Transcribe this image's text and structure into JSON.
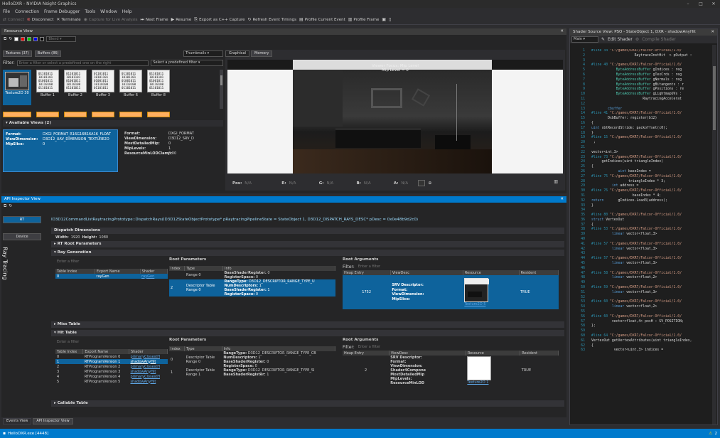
{
  "window": {
    "title": "HelloDXR - NVIDIA Nsight Graphics",
    "controls": [
      "–",
      "□",
      "✕"
    ]
  },
  "menu": [
    "File",
    "Connection",
    "Frame Debugger",
    "Tools",
    "Window",
    "Help"
  ],
  "toolbar": {
    "connect": "Connect",
    "disconnect": "Disconnect",
    "terminate": "Terminate",
    "capture": "Capture for Live Analysis",
    "next_frame": "Next Frame",
    "resume": "Resume",
    "export": "Export as C++ Capture",
    "refresh": "Refresh Event Timings",
    "profile_current": "Profile Current Event",
    "profile_frame": "Profile Frame"
  },
  "resource_view": {
    "title": "Resource View",
    "blend": "Blend",
    "tab_textures": "Textures (37)",
    "tab_buffers": "Buffers (86)",
    "view_mode": "Thumbnails",
    "filter_label": "Filter:",
    "filter_placeholder": "Enter a filter or select a predefined one on the right",
    "predefined_placeholder": "Select a predefined filter",
    "texture_label": "Texture2D 30",
    "buffer_bits": "01101011\n10101101\n01001011\n10110100\n01101011",
    "buffers": [
      "Buffer 1",
      "Buffer 2",
      "Buffer 3",
      "Buffer 6",
      "Buffer 8"
    ],
    "available_views": "Available Views (2)",
    "view1": {
      "format_k": "Format:",
      "format_v": "DXGI_FORMAT_R16G16B16A16_FLOAT",
      "dim_k": "ViewDimension:",
      "dim_v": "D3D12_UAV_DIMENSION_TEXTURE2D",
      "mip_k": "MipSlice:",
      "mip_v": "0"
    },
    "view2": {
      "format_k": "Format:",
      "format_v": "DXGI_FORMAT",
      "dim_k": "ViewDimension:",
      "dim_v": "D3D12_SRV_D",
      "mdm_k": "MostDetailedMip:",
      "mdm_v": "0",
      "ml_k": "MipLevels:",
      "ml_v": "1",
      "rmc_k": "ResourceMinLODClamp:",
      "rmc_v": "0.00"
    }
  },
  "graphical": {
    "tab_graphical": "Graphical",
    "tab_memory": "Memory",
    "overlay1": "Viewer Focus: Mip Level",
    "overlay2": "Mip Level = 0",
    "pos_k": "Pos:",
    "na": "N/A",
    "r_k": "R:",
    "g_k": "G:",
    "b_k": "B:",
    "a_k": "A:"
  },
  "api_inspector": {
    "title": "API Inspector View",
    "rt_button": "RT",
    "device_button": "Device",
    "side_label": "Ray Tracing",
    "call": "ID3D12CommandListRaytracingPrototype::DispatchRays(ID3D12StateObjectPrototype* pRaytracingPipelineState = StateObject 1, D3D12_DISPATCH_RAYS_DESC* pDesc = 0x0e48b9d2c0)",
    "dispatch_dims": "Dispatch Dimensions",
    "width_k": "Width:",
    "width_v": "1920",
    "height_k": "Height:",
    "height_v": "1080",
    "rt_root_params": "RT Root Parameters",
    "ray_generation": "Ray Generation",
    "miss_table": "Miss Table",
    "hit_table": "Hit Table",
    "callable_table": "Callable Table",
    "filter_placeholder": "Enter a filter",
    "root_parameters": "Root Parameters",
    "root_arguments": "Root Arguments",
    "filter_label": "Filter:",
    "cols_table": [
      "Table Index",
      "Export Name",
      "Shader"
    ],
    "cols_root": [
      "Index",
      "Type",
      "Info"
    ],
    "cols_args": [
      "Heap Entry",
      "ViewDesc",
      "Resource",
      "Resident"
    ],
    "raygen_row": [
      "0",
      "rayGen",
      "rayGen"
    ],
    "root_rows": [
      {
        "index": "",
        "type": "Range 0",
        "info": [
          [
            "BaseShaderRegister:",
            "0"
          ],
          [
            "RegisterSpace:",
            "0"
          ]
        ]
      },
      {
        "index": "2",
        "type": "Descriptor Table\nRange 0",
        "info": [
          [
            "RangeType:",
            "D3D12_DESCRIPTOR_RANGE_TYPE_U"
          ],
          [
            "NumDescriptors:",
            "1"
          ],
          [
            "BaseShaderRegister:",
            "1"
          ],
          [
            "RegisterSpace:",
            "0"
          ]
        ]
      }
    ],
    "arg_row": {
      "heap": "1752",
      "view": "SRV Descriptor:\nFormat:\nViewDimension:\nMipSlice:",
      "res": "Texture2D 5",
      "resident": "TRUE"
    },
    "hit_rows": [
      [
        "0",
        "RTProgramVersion 0",
        "primaryClosestH"
      ],
      [
        "1",
        "RTProgramVersion 1",
        "shadowAnyHit"
      ],
      [
        "2",
        "RTProgramVersion 2",
        "primaryClosestH"
      ],
      [
        "3",
        "RTProgramVersion 3",
        "shadowAnyHit"
      ],
      [
        "4",
        "RTProgramVersion 4",
        "primaryClosestH"
      ],
      [
        "5",
        "RTProgramVersion 5",
        "shadowAnyHit"
      ]
    ],
    "hit_root_rows": [
      {
        "index": "0",
        "type": "Descriptor Table\nRange 0",
        "info": [
          [
            "RangeType:",
            "D3D12_DESCRIPTOR_RANGE_TYPE_CB"
          ],
          [
            "NumDescriptors:",
            "1"
          ],
          [
            "BaseShaderRegister:",
            "0"
          ],
          [
            "RegisterSpace:",
            "0"
          ]
        ]
      },
      {
        "index": "1",
        "type": "Descriptor Table\nRange 1",
        "info": [
          [
            "RangeType:",
            "D3D12_DESCRIPTOR_RANGE_TYPE_SI"
          ],
          [
            "BaseShaderRegister:",
            "1"
          ]
        ]
      }
    ],
    "hit_arg_row": {
      "heap": "2",
      "view": "SRV Descriptor:\nFormat:\nViewDimension:\nShader4Compone\nMostDetailedMip\nMipLevels:\nResourceMinLOD",
      "res": "Texture2D 1",
      "resident": "TRUE"
    }
  },
  "bottom_tabs": [
    "Events View",
    "API Inspector View"
  ],
  "status": {
    "left": "HelloDXR.exe [4448]",
    "right": "2"
  },
  "shader": {
    "title": "Shader Source View: PSO - StateObject 1, DXR - shadowAnyHit",
    "dropdown": "Main",
    "edit": "Edit Shader",
    "compile": "Compile Shader",
    "lines": [
      [
        {
          "c": "ln",
          "t": "#line 34 "
        },
        {
          "c": "str",
          "t": "\"C:/games/DXR7/Falcor-Official/1.0/"
        }
      ],
      [
        {
          "c": "",
          "t": "                     RaytraceInstHit  > pOutput : "
        }
      ],
      [
        {
          "c": "",
          "t": ""
        }
      ],
      [
        {
          "c": "ln",
          "t": "#line 40 "
        },
        {
          "c": "str",
          "t": "\"C:/games/DXR7/Falcor-Official/1.0/"
        }
      ],
      [
        {
          "c": "ty",
          "t": "            ByteAddressBuffer"
        },
        {
          "c": "",
          "t": " gIndices : reg"
        }
      ],
      [
        {
          "c": "ty",
          "t": "            ByteAddressBuffer"
        },
        {
          "c": "",
          "t": " gTexCrds : reg"
        }
      ],
      [
        {
          "c": "ty",
          "t": "            ByteAddressBuffer"
        },
        {
          "c": "",
          "t": " gNormals : reg"
        }
      ],
      [
        {
          "c": "ty",
          "t": "            ByteAddressBuffer"
        },
        {
          "c": "",
          "t": " gBitangents : r"
        }
      ],
      [
        {
          "c": "ty",
          "t": "            ByteAddressBuffer"
        },
        {
          "c": "",
          "t": " gPositions : re"
        }
      ],
      [
        {
          "c": "ty",
          "t": "            ByteAddressBuffer"
        },
        {
          "c": "",
          "t": " gLightmapUVs : "
        }
      ],
      [
        {
          "c": "",
          "t": "                         RaytracingAccelerat"
        }
      ],
      [
        {
          "c": "",
          "t": ""
        }
      ],
      [
        {
          "c": "kw",
          "t": "        cbuffer"
        }
      ],
      [
        {
          "c": "ln",
          "t": "#line 41 "
        },
        {
          "c": "str",
          "t": "\"C:/games/DXR7/Falcor-Official/1.0/"
        }
      ],
      [
        {
          "c": "",
          "t": "        DxbBuffer: register(b12)"
        }
      ],
      [
        {
          "c": "",
          "t": "{"
        }
      ],
      [
        {
          "c": "kw",
          "t": "uint"
        },
        {
          "c": "",
          "t": " sbtRecordStride: packoffset(c0);"
        }
      ],
      [
        {
          "c": "",
          "t": "}"
        }
      ],
      [
        {
          "c": "ln",
          "t": "#line 15 "
        },
        {
          "c": "str",
          "t": "\"C:/games/DXR7/Falcor-Official/1.0/"
        }
      ],
      [
        {
          "c": "",
          "t": " ;"
        }
      ],
      [
        {
          "c": "",
          "t": ""
        }
      ],
      [
        {
          "c": "",
          "t": "vector<int,3>"
        }
      ],
      [
        {
          "c": "ln",
          "t": "#line 73 "
        },
        {
          "c": "str",
          "t": "\"C:/games/DXR7/Falcor-Official/1.0/"
        }
      ],
      [
        {
          "c": "",
          "t": "     getIndices(uint triangleIndex)"
        }
      ],
      [
        {
          "c": "",
          "t": "{"
        }
      ],
      [
        {
          "c": "kw",
          "t": "             uint"
        },
        {
          "c": "",
          "t": " baseIndex ="
        }
      ],
      [
        {
          "c": "ln",
          "t": "#line 75 "
        },
        {
          "c": "str",
          "t": "\"C:/games/DXR7/Falcor-Official/1.0/"
        }
      ],
      [
        {
          "c": "",
          "t": "                  triangleIndex * 3;"
        }
      ],
      [
        {
          "c": "kw",
          "t": "          int"
        },
        {
          "c": "",
          "t": " address ="
        }
      ],
      [
        {
          "c": "ln",
          "t": "#line 76 "
        },
        {
          "c": "str",
          "t": "\"C:/games/DXR7/Falcor-Official/1.0/"
        }
      ],
      [
        {
          "c": "",
          "t": "                    baseIndex * 4;"
        }
      ],
      [
        {
          "c": "kw",
          "t": "return"
        },
        {
          "c": "",
          "t": "       gIndices.Load3(address);"
        }
      ],
      [
        {
          "c": "",
          "t": "}"
        }
      ],
      [
        {
          "c": "",
          "t": ""
        }
      ],
      [
        {
          "c": "ln",
          "t": "#line 80 "
        },
        {
          "c": "str",
          "t": "\"C:/games/DXR7/Falcor-Official/1.0/"
        }
      ],
      [
        {
          "c": "kw",
          "t": "struct"
        },
        {
          "c": "",
          "t": " VertexOut"
        }
      ],
      [
        {
          "c": "",
          "t": "{"
        }
      ],
      [
        {
          "c": "ln",
          "t": "#line 53 "
        },
        {
          "c": "str",
          "t": "\"C:/games/DXR7/Falcor-Official/1.0/"
        }
      ],
      [
        {
          "c": "",
          "t": "          "
        },
        {
          "c": "kw",
          "t": "linear"
        },
        {
          "c": "",
          "t": " vector<float,3> "
        }
      ],
      [
        {
          "c": "",
          "t": ""
        }
      ],
      [
        {
          "c": "ln",
          "t": "#line 57 "
        },
        {
          "c": "str",
          "t": "\"C:/games/DXR7/Falcor-Official/1.0/"
        }
      ],
      [
        {
          "c": "",
          "t": "          "
        },
        {
          "c": "kw",
          "t": "linear"
        },
        {
          "c": "",
          "t": " vector<float,3> "
        }
      ],
      [
        {
          "c": "",
          "t": ""
        }
      ],
      [
        {
          "c": "ln",
          "t": "#line 57 "
        },
        {
          "c": "str",
          "t": "\"C:/games/DXR7/Falcor-Official/1.0/"
        }
      ],
      [
        {
          "c": "",
          "t": "          "
        },
        {
          "c": "kw",
          "t": "linear"
        },
        {
          "c": "",
          "t": " vector<float,3> "
        }
      ],
      [
        {
          "c": "",
          "t": ""
        }
      ],
      [
        {
          "c": "ln",
          "t": "#line 58 "
        },
        {
          "c": "str",
          "t": "\"C:/games/DXR7/Falcor-Official/1.0/"
        }
      ],
      [
        {
          "c": "",
          "t": "          "
        },
        {
          "c": "kw",
          "t": "linear"
        },
        {
          "c": "",
          "t": " vector<float,2> "
        }
      ],
      [
        {
          "c": "",
          "t": ""
        }
      ],
      [
        {
          "c": "ln",
          "t": "#line 59 "
        },
        {
          "c": "str",
          "t": "\"C:/games/DXR7/Falcor-Official/1.0/"
        }
      ],
      [
        {
          "c": "",
          "t": "          "
        },
        {
          "c": "kw",
          "t": "linear"
        },
        {
          "c": "",
          "t": " vector<float,3> "
        }
      ],
      [
        {
          "c": "",
          "t": ""
        }
      ],
      [
        {
          "c": "ln",
          "t": "#line 60 "
        },
        {
          "c": "str",
          "t": "\"C:/games/DXR7/Falcor-Official/1.0/"
        }
      ],
      [
        {
          "c": "",
          "t": "          "
        },
        {
          "c": "kw",
          "t": "linear"
        },
        {
          "c": "",
          "t": " vector<float,2> "
        }
      ],
      [
        {
          "c": "",
          "t": ""
        }
      ],
      [
        {
          "c": "ln",
          "t": "#line 60 "
        },
        {
          "c": "str",
          "t": "\"C:/games/DXR7/Falcor-Official/1.0/"
        }
      ],
      [
        {
          "c": "",
          "t": "          vector<float,4> posH : SV_POSITION;"
        }
      ],
      [
        {
          "c": "",
          "t": "};"
        }
      ],
      [
        {
          "c": "",
          "t": ""
        }
      ],
      [
        {
          "c": "ln",
          "t": "#line 64 "
        },
        {
          "c": "str",
          "t": "\"C:/games/DXR7/Falcor-Official/1.0/"
        }
      ],
      [
        {
          "c": "",
          "t": "VertexOut getVertexAttributes(uint triangleIndex, "
        }
      ],
      [
        {
          "c": "",
          "t": "{"
        }
      ],
      [
        {
          "c": "",
          "t": "           vector<uint,3> indices ="
        }
      ]
    ]
  }
}
